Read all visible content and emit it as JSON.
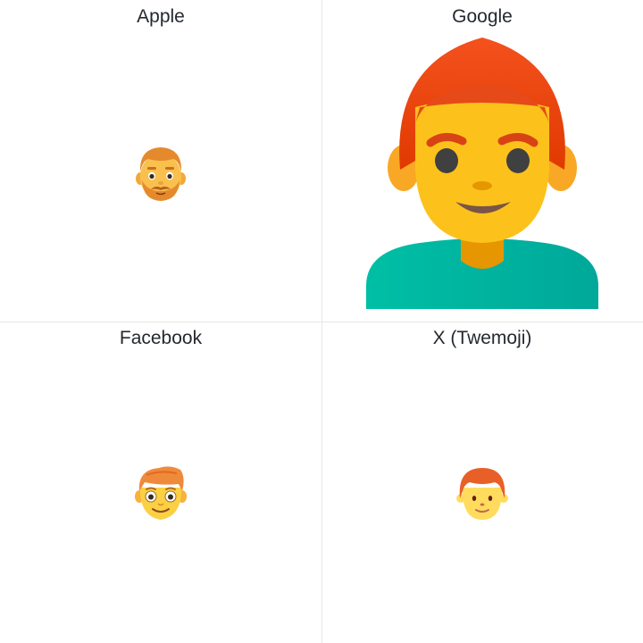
{
  "cells": [
    {
      "platform_label": "Apple",
      "emoji_icon": "man-red-hair-icon"
    },
    {
      "platform_label": "Google",
      "emoji_icon": "man-red-hair-icon"
    },
    {
      "platform_label": "Facebook",
      "emoji_icon": "man-red-hair-icon"
    },
    {
      "platform_label": "X (Twemoji)",
      "emoji_icon": "man-red-hair-icon"
    }
  ]
}
